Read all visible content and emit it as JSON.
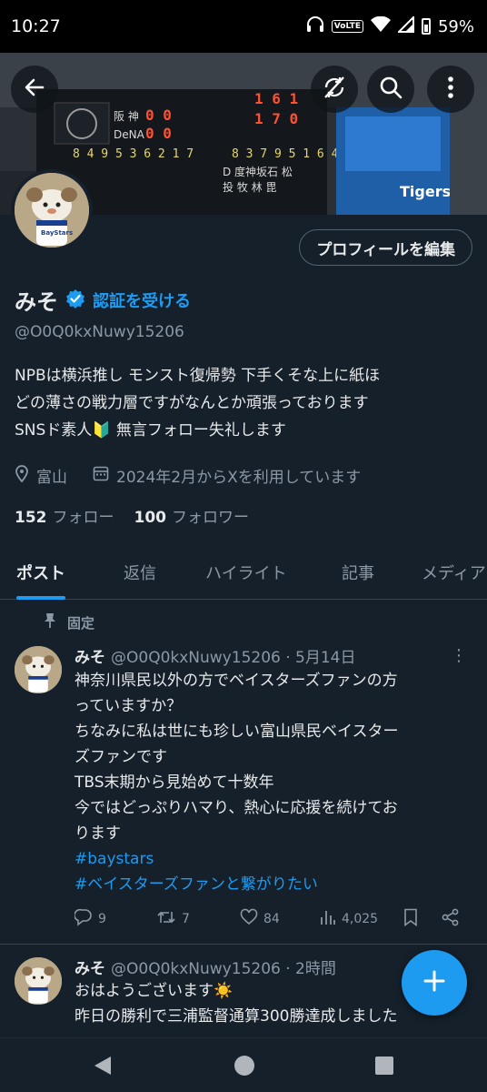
{
  "status_bar": {
    "time": "10:27",
    "network": "VoLTE",
    "battery": "59%"
  },
  "header": {
    "back_icon": "arrow-left-icon",
    "sync_icon": "sync-off-icon",
    "search_icon": "search-icon",
    "more_icon": "more-vertical-icon"
  },
  "profile": {
    "edit_button": "プロフィールを編集",
    "name": "みそ",
    "verify_link": "認証を受ける",
    "handle": "@O0Q0kxNuwy15206",
    "bio_lines": [
      "NPBは横浜推し モンスト復帰勢 下手くそな上に紙ほ",
      "どの薄さの戦力層ですがなんとか頑張っております",
      "SNSド素人🔰 無言フォロー失礼します"
    ],
    "location": "富山",
    "joined": "2024年2月からXを利用しています",
    "following_count": "152",
    "following_label": "フォロー",
    "followers_count": "100",
    "followers_label": "フォロワー"
  },
  "tabs": [
    "ポスト",
    "返信",
    "ハイライト",
    "記事",
    "メディア"
  ],
  "pinned_label": "固定",
  "tweets": [
    {
      "name": "みそ",
      "meta": "@O0Q0kxNuwy15206 · 5月14日",
      "lines": [
        "神奈川県民以外の方でベイスターズファンの方",
        "っていますか？",
        "ちなみに私は世にも珍しい富山県民ベイスター",
        "ズファンです",
        "TBS末期から見始めて十数年",
        "今ではどっぷりハマり、熱心に応援を続けてお",
        "ります"
      ],
      "hashtags": [
        "#baystars",
        "#ベイスターズファンと繋がりたい"
      ],
      "replies": "9",
      "retweets": "7",
      "likes": "84",
      "views": "4,025"
    },
    {
      "name": "みそ",
      "meta": "@O0Q0kxNuwy15206 · 2時間",
      "lines": [
        "おはようございます☀️",
        "昨日の勝利で三浦監督通算300勝達成しました"
      ]
    }
  ],
  "colors": {
    "accent": "#1d9bf0",
    "background": "#15202b",
    "muted": "#8b98a5"
  }
}
